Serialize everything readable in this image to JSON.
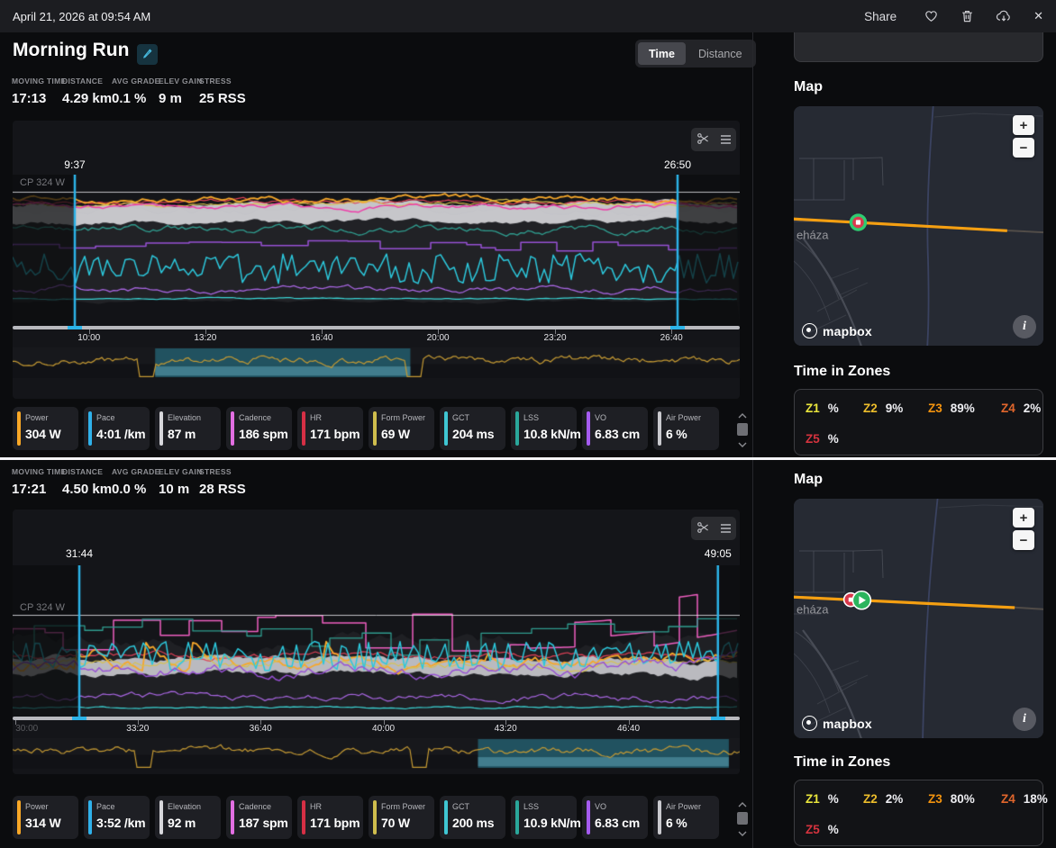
{
  "topbar": {
    "date": "April 21, 2026 at 09:54 AM",
    "share_label": "Share"
  },
  "header": {
    "title": "Morning Run",
    "toggle": {
      "options": [
        "Time",
        "Distance"
      ],
      "active": "Time"
    }
  },
  "sections": [
    {
      "stats": [
        {
          "label": "MOVING TIME",
          "value": "17:13"
        },
        {
          "label": "DISTANCE",
          "value": "4.29 km"
        },
        {
          "label": "AVG GRADE",
          "value": "0.1 %"
        },
        {
          "label": "ELEV GAIN",
          "value": "9 m"
        },
        {
          "label": "STRESS",
          "value": "25 RSS"
        }
      ],
      "chart": {
        "cp_label": "CP 324 W",
        "cp_y": 0.113,
        "accent": "#2cb3e8",
        "seed": 11,
        "selection": {
          "start": 0.0855,
          "end": 0.9145,
          "start_label": "9:37",
          "end_label": "26:50"
        },
        "ticks": [
          {
            "label": "10:00",
            "x": 0.105
          },
          {
            "label": "13:20",
            "x": 0.265
          },
          {
            "label": "16:40",
            "x": 0.425
          },
          {
            "label": "20:00",
            "x": 0.585
          },
          {
            "label": "23:20",
            "x": 0.746
          },
          {
            "label": "26:40",
            "x": 0.906
          }
        ],
        "fills": [
          {
            "base": 0.24,
            "amp": 0.05,
            "color": "#212226"
          },
          {
            "base": 0.84,
            "amp": 0.015,
            "color": "#121317"
          }
        ],
        "series": [
          {
            "name": "elevation",
            "color": "rgba(216,216,221,0.9)",
            "base": 0.2,
            "amp": 0.022,
            "style": "band",
            "thickness": 0.12
          },
          {
            "name": "heart-rate",
            "color": "#dd4056",
            "base": 0.185,
            "amp": 0.02,
            "style": "noise",
            "w": 1.2
          },
          {
            "name": "power",
            "color": "#f7a82a",
            "base": 0.165,
            "amp": 0.028,
            "style": "noise",
            "w": 1.8
          },
          {
            "name": "form-power",
            "color": "#d8c24d",
            "base": 0.19,
            "amp": 0.02,
            "style": "noise",
            "w": 1.1
          },
          {
            "name": "cadence",
            "color": "#ee3fa9",
            "base": 0.21,
            "amp": 0.022,
            "style": "noise",
            "w": 1.5
          },
          {
            "name": "gct",
            "color": "#2f9d8f",
            "base": 0.36,
            "amp": 0.035,
            "style": "noise",
            "w": 1.3
          },
          {
            "name": "vo",
            "color": "#9750d4",
            "base": 0.47,
            "amp": 0.035,
            "style": "step",
            "w": 1.5
          },
          {
            "name": "pace",
            "color": "#2cc8dc",
            "base": 0.62,
            "amp": 0.1,
            "style": "jag",
            "w": 1.5
          },
          {
            "name": "impact",
            "color": "#a765e0",
            "base": 0.76,
            "amp": 0.028,
            "style": "noise",
            "w": 1.3
          },
          {
            "name": "lss",
            "color": "#3bd6d6",
            "base": 0.82,
            "amp": 0.006,
            "style": "noise",
            "w": 1.2
          }
        ],
        "overview": {
          "sel": [
            0.196,
            0.547
          ],
          "dips": [
            0.185,
            0.553
          ],
          "seed": 5,
          "line_color": "#c59a33",
          "sel_color": "rgba(36,98,114,0.8)",
          "band_color": "rgba(98,168,188,0.5)"
        }
      },
      "metrics": [
        {
          "name": "Power",
          "value": "304 W",
          "color": "#f9a826"
        },
        {
          "name": "Pace",
          "value": "4:01 /km",
          "color": "#2fb1ea"
        },
        {
          "name": "Elevation",
          "value": "87 m",
          "color": "#d7d7db"
        },
        {
          "name": "Cadence",
          "value": "186 spm",
          "color": "#e26ee2"
        },
        {
          "name": "HR",
          "value": "171 bpm",
          "color": "#d62f45"
        },
        {
          "name": "Form Power",
          "value": "69 W",
          "color": "#cfbd4d"
        },
        {
          "name": "GCT",
          "value": "204 ms",
          "color": "#3fc6d3"
        },
        {
          "name": "LSS",
          "value": "10.8 kN/m",
          "color": "#2aa79b"
        },
        {
          "name": "VO",
          "value": "6.83 cm",
          "color": "#a55bf0"
        },
        {
          "name": "Air Power",
          "value": "6 %",
          "color": "#c9c9ce"
        }
      ],
      "map": {
        "heading": "Map",
        "place": "eháza",
        "attribution": "mapbox",
        "route": {
          "y1": 0.47,
          "y2": 0.52,
          "end": 0.855
        },
        "label_y": 0.555,
        "variant": 0,
        "markers": [
          {
            "type": "stop-ring",
            "x": 0.258
          }
        ]
      },
      "zones": {
        "heading": "Time in Zones",
        "rows": [
          [
            {
              "zone": "Z1",
              "value": "%",
              "color": "#e9e53c"
            },
            {
              "zone": "Z2",
              "value": "9%",
              "color": "#edbd2b"
            },
            {
              "zone": "Z3",
              "value": "89%",
              "color": "#f3930e"
            },
            {
              "zone": "Z4",
              "value": "2%",
              "color": "#e1662c"
            }
          ],
          [
            {
              "zone": "Z5",
              "value": "%",
              "color": "#d5333e"
            }
          ]
        ]
      }
    },
    {
      "stats": [
        {
          "label": "MOVING TIME",
          "value": "17:21"
        },
        {
          "label": "DISTANCE",
          "value": "4.50 km"
        },
        {
          "label": "AVG GRADE",
          "value": "0.0 %"
        },
        {
          "label": "ELEV GAIN",
          "value": "10 m"
        },
        {
          "label": "STRESS",
          "value": "28 RSS"
        }
      ],
      "chart": {
        "cp_label": "CP 324 W",
        "cp_y": 0.327,
        "accent": "#2cb3e8",
        "seed": 23,
        "selection": {
          "start": 0.0917,
          "end": 0.97,
          "start_label": "31:44",
          "end_label": "49:05"
        },
        "ticks": [
          {
            "label": "30:00",
            "x": 0.004,
            "dim": true
          },
          {
            "label": "33:20",
            "x": 0.172
          },
          {
            "label": "36:40",
            "x": 0.341
          },
          {
            "label": "40:00",
            "x": 0.51
          },
          {
            "label": "43:20",
            "x": 0.678
          },
          {
            "label": "46:40",
            "x": 0.847
          }
        ],
        "fills": [
          {
            "base": 0.5,
            "amp": 0.07,
            "color": "#1f2024"
          }
        ],
        "series": [
          {
            "name": "cadence",
            "color": "#ee5ec0",
            "base": 0.45,
            "amp": 0.17,
            "style": "step",
            "w": 1.5,
            "trend": -0.14
          },
          {
            "name": "gct",
            "color": "#2f9d8f",
            "base": 0.5,
            "amp": 0.15,
            "style": "step",
            "w": 1.3
          },
          {
            "name": "elevation",
            "color": "rgba(214,214,219,0.85)",
            "base": 0.62,
            "amp": 0.03,
            "style": "band",
            "thickness": 0.1
          },
          {
            "name": "heart-rate",
            "color": "#dd4056",
            "base": 0.6,
            "amp": 0.03,
            "style": "noise",
            "w": 1.2
          },
          {
            "name": "power",
            "color": "#f7a82a",
            "base": 0.66,
            "amp": 0.06,
            "style": "spiky",
            "w": 1.8,
            "trend": -0.12
          },
          {
            "name": "form-power",
            "color": "#d8c24d",
            "base": 0.65,
            "amp": 0.04,
            "style": "noise",
            "w": 1.1
          },
          {
            "name": "pace",
            "color": "#2cc8dc",
            "base": 0.6,
            "amp": 0.1,
            "style": "jag",
            "w": 1.5
          },
          {
            "name": "vo",
            "color": "#9750d4",
            "base": 0.7,
            "amp": 0.06,
            "style": "noise",
            "w": 1.4,
            "trend": -0.06
          },
          {
            "name": "impact",
            "color": "#a765e0",
            "base": 0.88,
            "amp": 0.035,
            "style": "noise",
            "w": 1.2
          },
          {
            "name": "lss",
            "color": "#3bd6d6",
            "base": 0.94,
            "amp": 0.008,
            "style": "noise",
            "w": 1.2
          }
        ],
        "overview": {
          "sel": [
            0.64,
            0.985
          ],
          "dips": [
            0.18,
            0.56
          ],
          "seed": 9,
          "line_color": "#c59a33",
          "sel_color": "rgba(36,98,114,0.8)",
          "band_color": "rgba(98,168,188,0.5)"
        }
      },
      "metrics": [
        {
          "name": "Power",
          "value": "314 W",
          "color": "#f9a826"
        },
        {
          "name": "Pace",
          "value": "3:52 /km",
          "color": "#2fb1ea"
        },
        {
          "name": "Elevation",
          "value": "92 m",
          "color": "#d7d7db"
        },
        {
          "name": "Cadence",
          "value": "187 spm",
          "color": "#e26ee2"
        },
        {
          "name": "HR",
          "value": "171 bpm",
          "color": "#d62f45"
        },
        {
          "name": "Form Power",
          "value": "70 W",
          "color": "#cfbd4d"
        },
        {
          "name": "GCT",
          "value": "200 ms",
          "color": "#3fc6d3"
        },
        {
          "name": "LSS",
          "value": "10.9 kN/m",
          "color": "#2aa79b"
        },
        {
          "name": "VO",
          "value": "6.83 cm",
          "color": "#a55bf0"
        },
        {
          "name": "Air Power",
          "value": "6 %",
          "color": "#c9c9ce"
        }
      ],
      "map": {
        "heading": "Map",
        "place": "eháza",
        "attribution": "mapbox",
        "route": {
          "y1": 0.41,
          "y2": 0.455,
          "end": 0.885
        },
        "label_y": 0.48,
        "variant": 1,
        "markers": [
          {
            "type": "stop",
            "x": 0.228
          },
          {
            "type": "start",
            "x": 0.272
          }
        ]
      },
      "zones": {
        "heading": "Time in Zones",
        "rows": [
          [
            {
              "zone": "Z1",
              "value": "%",
              "color": "#e9e53c"
            },
            {
              "zone": "Z2",
              "value": "2%",
              "color": "#edbd2b"
            },
            {
              "zone": "Z3",
              "value": "80%",
              "color": "#f3930e"
            },
            {
              "zone": "Z4",
              "value": "18%",
              "color": "#e1662c"
            }
          ],
          [
            {
              "zone": "Z5",
              "value": "%",
              "color": "#d5333e"
            }
          ]
        ]
      }
    }
  ]
}
